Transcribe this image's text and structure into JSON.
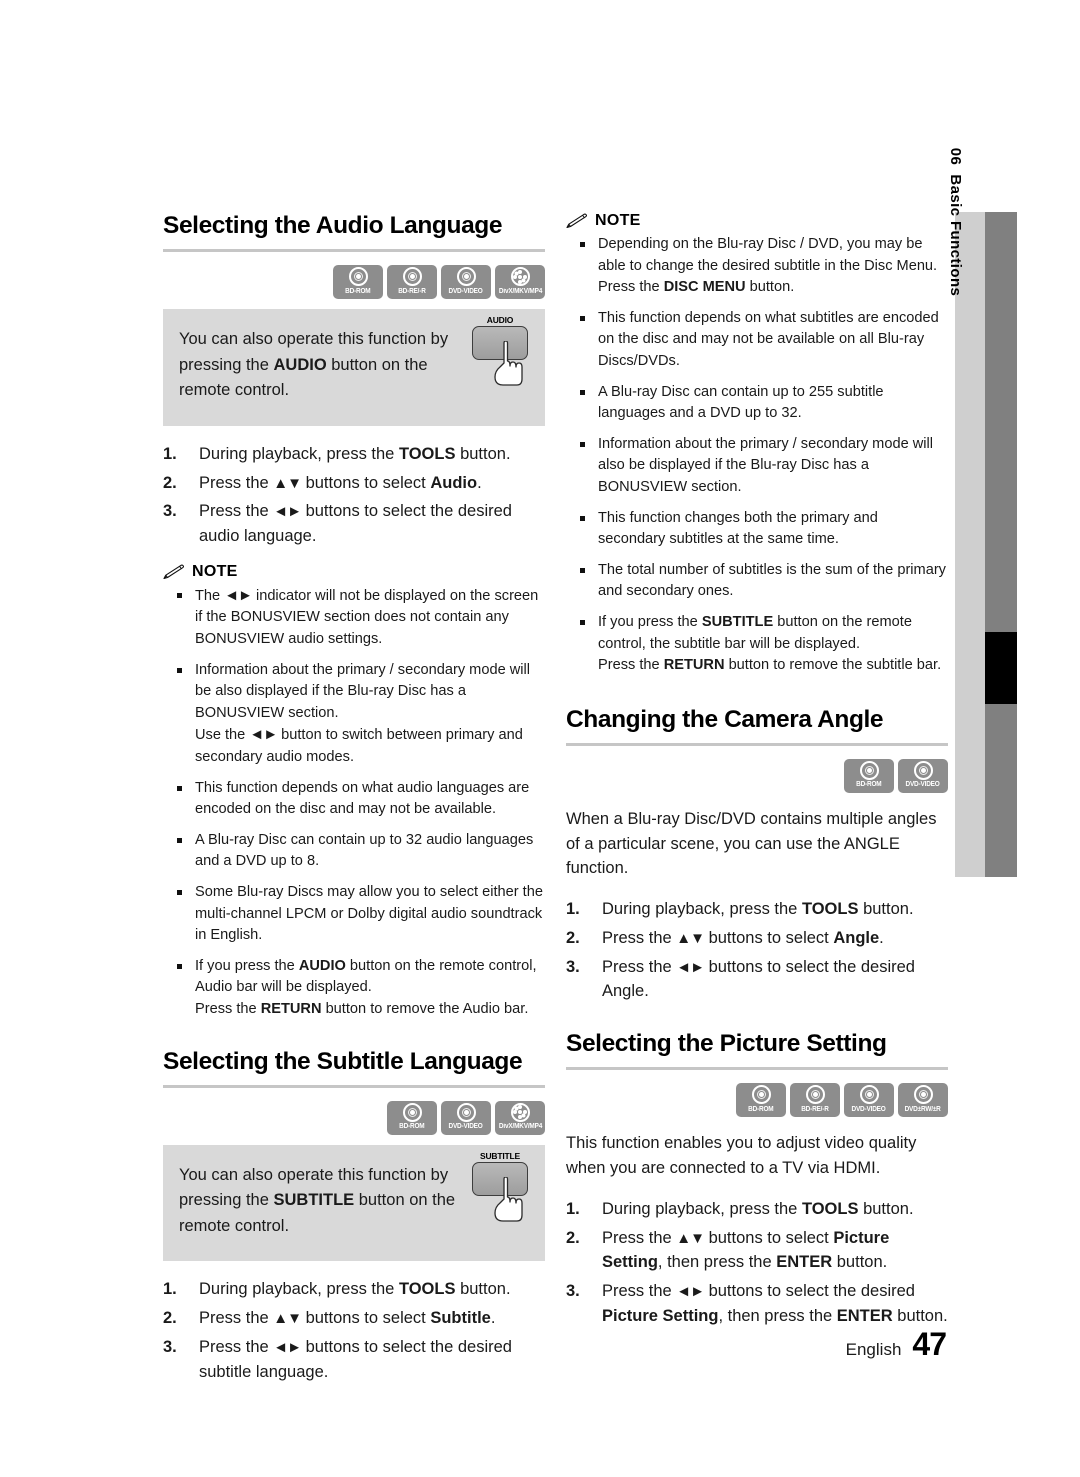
{
  "chapter_tab": {
    "number": "06",
    "label": "Basic Functions"
  },
  "footer": {
    "language": "English",
    "page_number": "47"
  },
  "note_label": "NOTE",
  "left_column": {
    "audio_section": {
      "title": "Selecting the Audio Language",
      "badges": [
        "BD-ROM",
        "BD-RE/-R",
        "DVD-VIDEO",
        "DivX/MKV/MP4"
      ],
      "tip": {
        "text_before": "You can also operate this function by pressing the ",
        "bold": "AUDIO",
        "text_after": " button on the remote control.",
        "button_label": "AUDIO"
      },
      "steps": [
        {
          "num": "1.",
          "html": "During playback, press the <b>TOOLS</b> button."
        },
        {
          "num": "2.",
          "html": "Press the <span class=\"arrows\">▲▼</span> buttons to select <b>Audio</b>."
        },
        {
          "num": "3.",
          "html": "Press the <span class=\"arrows\">◄►</span> buttons to select the desired audio language."
        }
      ],
      "notes": [
        "The <span class=\"arrows\">◄►</span> indicator will not be displayed on the screen if the BONUSVIEW section does not contain any BONUSVIEW audio settings.",
        "Information about the primary / secondary mode will be also displayed if the Blu-ray Disc has a BONUSVIEW section.<br>Use the <span class=\"arrows\">◄►</span> button to switch between primary and secondary audio modes.",
        "This function depends on what audio languages are encoded on the disc and may not be available.",
        "A Blu-ray Disc can contain up to 32 audio languages and a DVD up to 8.",
        "Some Blu-ray Discs may allow you to select either the multi-channel LPCM or Dolby digital audio soundtrack in English.",
        "If you press the <b>AUDIO</b> button on the remote control, Audio bar will be displayed.<br>Press the <b>RETURN</b> button to remove the Audio bar."
      ]
    },
    "subtitle_section": {
      "title": "Selecting the Subtitle Language",
      "badges": [
        "BD-ROM",
        "DVD-VIDEO",
        "DivX/MKV/MP4"
      ],
      "tip": {
        "text_before": "You can also operate this function by pressing the ",
        "bold": "SUBTITLE",
        "text_after": " button on the remote control.",
        "button_label": "SUBTITLE"
      },
      "steps": [
        {
          "num": "1.",
          "html": "During playback, press the <b>TOOLS</b> button."
        },
        {
          "num": "2.",
          "html": "Press the <span class=\"arrows\">▲▼</span> buttons to select <b>Subtitle</b>."
        },
        {
          "num": "3.",
          "html": "Press the <span class=\"arrows\">◄►</span> buttons to select the desired subtitle language."
        }
      ]
    }
  },
  "right_column": {
    "subtitle_notes": [
      "Depending on the Blu-ray Disc / DVD, you may be able to change the desired subtitle in the Disc Menu. Press the <b>DISC MENU</b> button.",
      "This function depends on what subtitles are encoded on the disc and may not be available on all Blu-ray Discs/DVDs.",
      "A Blu-ray Disc can contain up to 255 subtitle languages and a DVD up to 32.",
      "Information about the primary / secondary mode will also be displayed if the Blu-ray Disc has a BONUSVIEW section.",
      "This function changes both the primary and secondary subtitles at the same time.",
      "The total number of subtitles is the sum of the primary and secondary ones.",
      "If you press the <b>SUBTITLE</b> button on the remote control, the subtitle bar will be displayed.<br>Press the <b>RETURN</b> button to remove the subtitle bar."
    ],
    "angle_section": {
      "title": "Changing the Camera Angle",
      "badges": [
        "BD-ROM",
        "DVD-VIDEO"
      ],
      "intro": "When a Blu-ray Disc/DVD contains multiple angles of a particular scene, you can use the ANGLE function.",
      "steps": [
        {
          "num": "1.",
          "html": "During playback, press the <b>TOOLS</b> button."
        },
        {
          "num": "2.",
          "html": "Press the <span class=\"arrows\">▲▼</span> buttons to select <b>Angle</b>."
        },
        {
          "num": "3.",
          "html": "Press the <span class=\"arrows\">◄►</span> buttons to select the desired Angle."
        }
      ]
    },
    "picture_section": {
      "title": "Selecting the Picture Setting",
      "badges": [
        "BD-ROM",
        "BD-RE/-R",
        "DVD-VIDEO",
        "DVD±RW/±R"
      ],
      "intro": "This function enables you to adjust video quality when you are connected to a TV via HDMI.",
      "steps": [
        {
          "num": "1.",
          "html": "During playback, press the <b>TOOLS</b> button."
        },
        {
          "num": "2.",
          "html": "Press the <span class=\"arrows\">▲▼</span> buttons to select <b>Picture Setting</b>, then press the <b>ENTER</b> button."
        },
        {
          "num": "3.",
          "html": "Press the <span class=\"arrows\">◄►</span> buttons to select the desired <b>Picture Setting</b>, then press the <b>ENTER</b> button."
        }
      ]
    }
  }
}
